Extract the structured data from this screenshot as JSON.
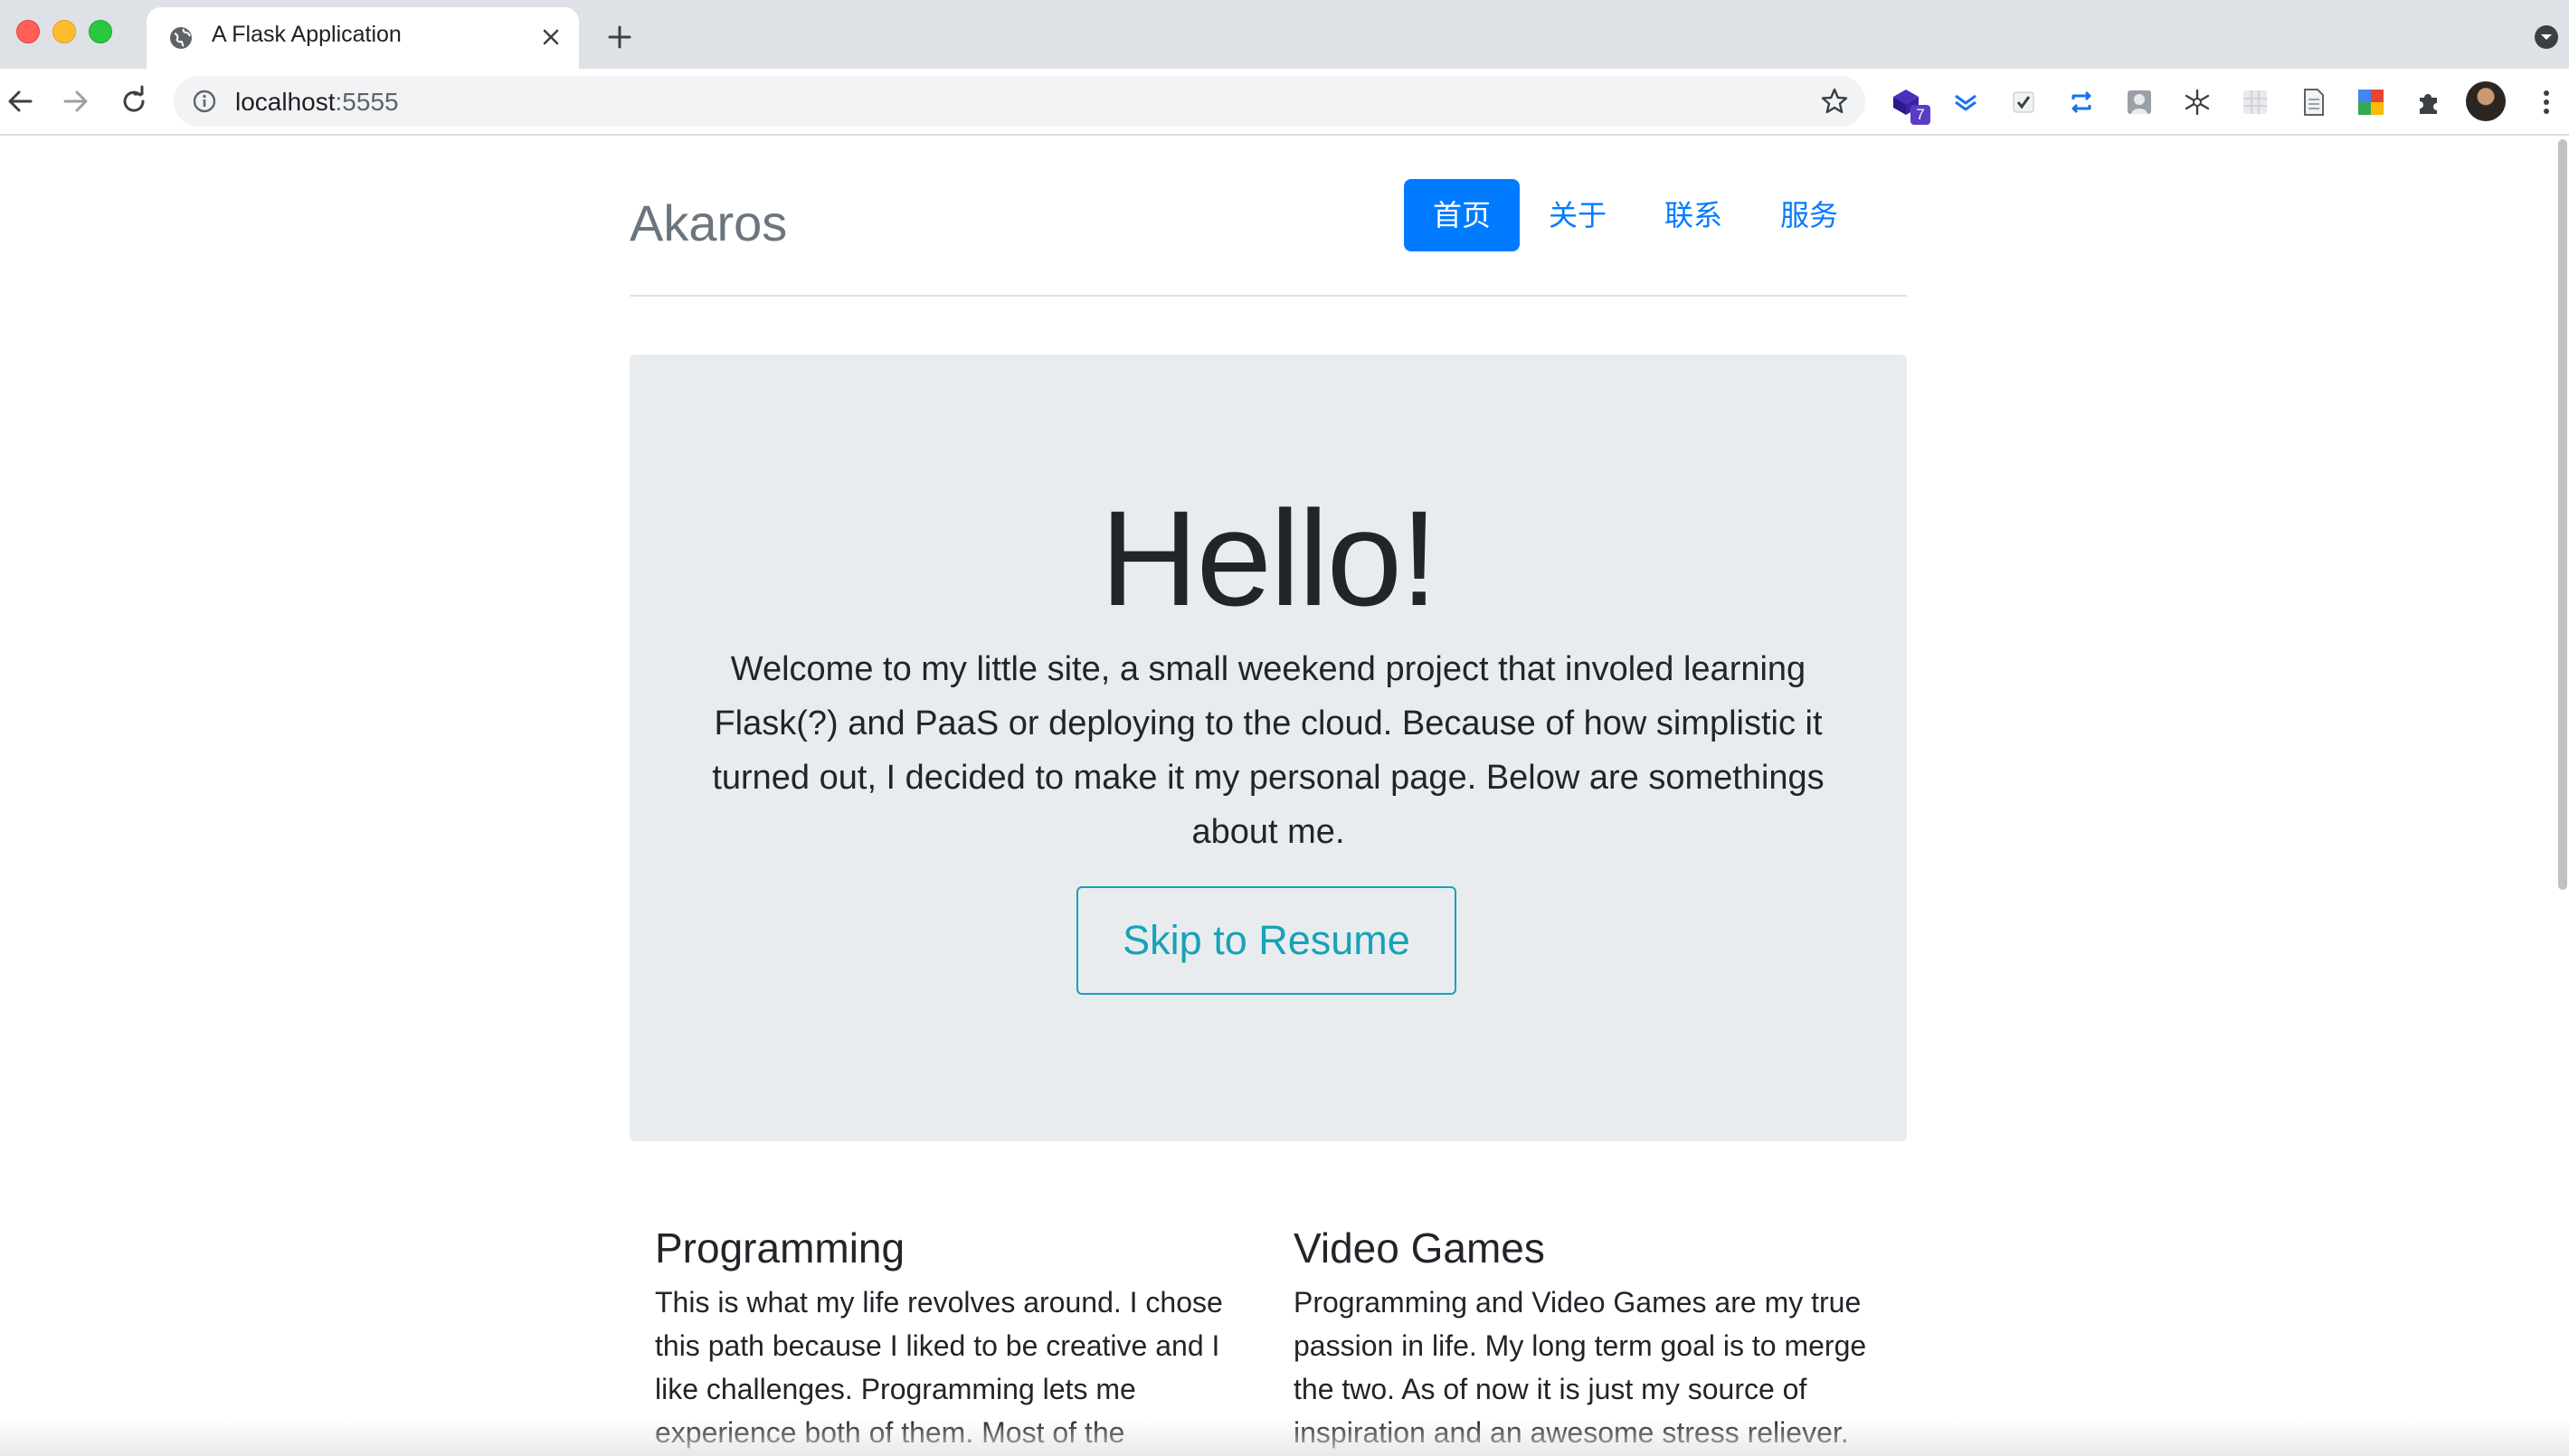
{
  "browser": {
    "tab_title": "A Flask Application",
    "url_host": "localhost",
    "url_port": ":5555",
    "extension_badge": "7"
  },
  "site": {
    "brand": "Akaros",
    "nav": [
      {
        "label": "首页",
        "active": true
      },
      {
        "label": "关于",
        "active": false
      },
      {
        "label": "联系",
        "active": false
      },
      {
        "label": "服务",
        "active": false
      }
    ]
  },
  "hero": {
    "heading": "Hello!",
    "text": "Welcome to my little site, a small weekend project that involed learning Flask(?) and PaaS or deploying to the cloud. Because of how simplistic it turned out, I decided to make it my personal page. Below are somethings about me.",
    "button": "Skip to Resume"
  },
  "sections": [
    {
      "title": "Programming",
      "text": "This is what my life revolves around. I chose this path because I liked to be creative and I like challenges. Programming lets me experience both of them. Most of the"
    },
    {
      "title": "Video Games",
      "text": "Programming and Video Games are my true passion in life. My long term goal is to merge the two. As of now it is just my source of inspiration and an awesome stress reliever."
    }
  ],
  "colors": {
    "primary": "#007bff",
    "info": "#17a2b8",
    "jumbotron": "#e9ecef",
    "brand_text": "#6c757d"
  }
}
